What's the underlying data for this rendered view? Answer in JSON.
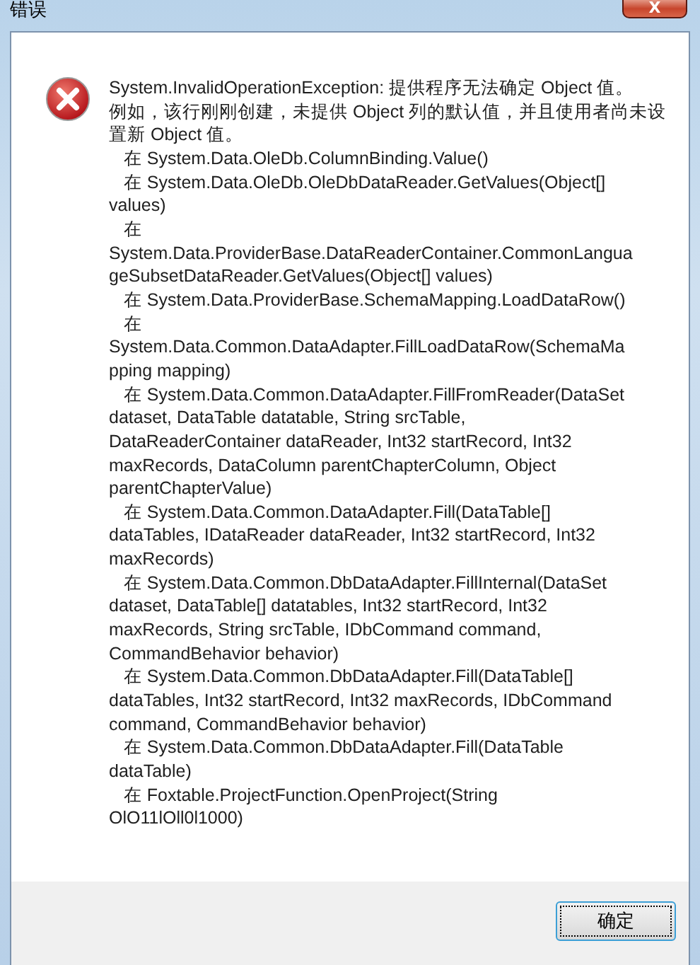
{
  "window": {
    "title": "错误",
    "close_label": "X"
  },
  "message": {
    "lines": [
      "System.InvalidOperationException: 提供程序无法确定 Object 值。",
      "例如，该行刚刚创建，未提供 Object 列的默认值，并且使用者尚未设",
      "置新 Object 值。",
      "   在 System.Data.OleDb.ColumnBinding.Value()",
      "   在 System.Data.OleDb.OleDbDataReader.GetValues(Object[]",
      "values)",
      "   在",
      "System.Data.ProviderBase.DataReaderContainer.CommonLangua",
      "geSubsetDataReader.GetValues(Object[] values)",
      "   在 System.Data.ProviderBase.SchemaMapping.LoadDataRow()",
      "   在",
      "System.Data.Common.DataAdapter.FillLoadDataRow(SchemaMa",
      "pping mapping)",
      "   在 System.Data.Common.DataAdapter.FillFromReader(DataSet",
      "dataset, DataTable datatable, String srcTable,",
      "DataReaderContainer dataReader, Int32 startRecord, Int32",
      "maxRecords, DataColumn parentChapterColumn, Object",
      "parentChapterValue)",
      "   在 System.Data.Common.DataAdapter.Fill(DataTable[]",
      "dataTables, IDataReader dataReader, Int32 startRecord, Int32",
      "maxRecords)",
      "   在 System.Data.Common.DbDataAdapter.FillInternal(DataSet",
      "dataset, DataTable[] datatables, Int32 startRecord, Int32",
      "maxRecords, String srcTable, IDbCommand command,",
      "CommandBehavior behavior)",
      "   在 System.Data.Common.DbDataAdapter.Fill(DataTable[]",
      "dataTables, Int32 startRecord, Int32 maxRecords, IDbCommand",
      "command, CommandBehavior behavior)",
      "   在 System.Data.Common.DbDataAdapter.Fill(DataTable",
      "dataTable)",
      "   在 Foxtable.ProjectFunction.OpenProject(String",
      "OlO11lOll0l1000)"
    ]
  },
  "buttons": [
    {
      "label": "确定",
      "focused": true
    }
  ]
}
